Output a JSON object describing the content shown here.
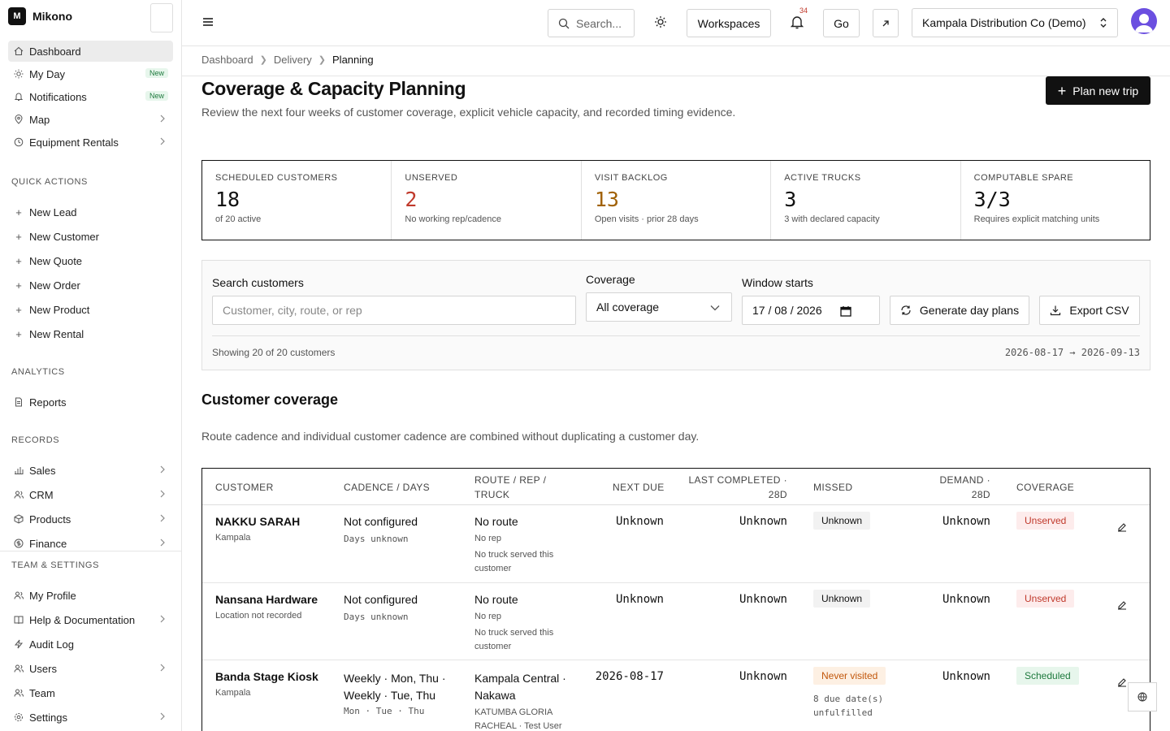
{
  "brand": {
    "logo_letter": "M",
    "name": "Mikono"
  },
  "sidebar": {
    "main": [
      {
        "label": "Dashboard",
        "icon": "home-icon",
        "active": true
      },
      {
        "label": "My Day",
        "icon": "sun-icon",
        "badge": "New"
      },
      {
        "label": "Notifications",
        "icon": "bell-icon",
        "badge": "New"
      },
      {
        "label": "Map",
        "icon": "map-pin-icon"
      },
      {
        "label": "Equipment Rentals",
        "icon": "clock-icon"
      }
    ],
    "quick_actions_label": "QUICK ACTIONS",
    "quick_actions": [
      "New Lead",
      "New Customer",
      "New Quote",
      "New Order",
      "New Product",
      "New Rental"
    ],
    "analytics_label": "ANALYTICS",
    "analytics": [
      {
        "label": "Reports",
        "icon": "file-icon"
      }
    ],
    "records_label": "RECORDS",
    "records": [
      {
        "label": "Sales",
        "icon": "bar-chart-icon"
      },
      {
        "label": "CRM",
        "icon": "users-icon"
      },
      {
        "label": "Products",
        "icon": "box-icon"
      },
      {
        "label": "Finance",
        "icon": "dollar-icon"
      }
    ],
    "team_label": "TEAM & SETTINGS",
    "team": [
      {
        "label": "My Profile",
        "icon": "users-icon"
      },
      {
        "label": "Help & Documentation",
        "icon": "book-icon"
      },
      {
        "label": "Audit Log",
        "icon": "activity-icon"
      },
      {
        "label": "Users",
        "icon": "users-icon"
      },
      {
        "label": "Team",
        "icon": "users-icon"
      },
      {
        "label": "Settings",
        "icon": "gear-icon"
      }
    ]
  },
  "topbar": {
    "search_placeholder": "Search...",
    "workspaces": "Workspaces",
    "notif_count": "34",
    "go": "Go",
    "company": "Kampala Distribution Co (Demo)"
  },
  "breadcrumb": [
    "Dashboard",
    "Delivery",
    "Planning"
  ],
  "page": {
    "title": "Coverage & Capacity Planning",
    "subtitle": "Review the next four weeks of customer coverage, explicit vehicle capacity, and recorded timing evidence.",
    "plan_button": "Plan new trip"
  },
  "kpis": [
    {
      "label": "SCHEDULED CUSTOMERS",
      "value": "18",
      "note": "of 20 active",
      "color": "#111111"
    },
    {
      "label": "UNSERVED",
      "value": "2",
      "note": "No working rep/cadence",
      "color": "#c0392b"
    },
    {
      "label": "VISIT BACKLOG",
      "value": "13",
      "note": "Open visits · prior 28 days",
      "color": "#a16207"
    },
    {
      "label": "ACTIVE TRUCKS",
      "value": "3",
      "note": "3 with declared capacity",
      "color": "#111111"
    },
    {
      "label": "COMPUTABLE SPARE",
      "value": "3/3",
      "note": "Requires explicit matching units",
      "color": "#111111"
    }
  ],
  "filters": {
    "search_label": "Search customers",
    "search_placeholder": "Customer, city, route, or rep",
    "coverage_label": "Coverage",
    "coverage_value": "All coverage",
    "window_label": "Window starts",
    "window_value": "17 / 08 / 2026",
    "generate_button": "Generate day plans",
    "export_button": "Export CSV",
    "showing": "Showing 20 of 20 customers",
    "range": "2026-08-17 → 2026-09-13"
  },
  "coverage_section": {
    "title": "Customer coverage",
    "subtitle": "Route cadence and individual customer cadence are combined without duplicating a customer day."
  },
  "table": {
    "headers": [
      "CUSTOMER",
      "CADENCE / DAYS",
      "ROUTE / REP / TRUCK",
      "NEXT DUE",
      "LAST COMPLETED · 28D",
      "MISSED",
      "DEMAND · 28D",
      "COVERAGE"
    ],
    "rows": [
      {
        "customer": "NAKKU SARAH",
        "location": "Kampala",
        "cadence": "Not configured",
        "days": "Days unknown",
        "route": "No route",
        "rep": "No rep",
        "truck": "No truck served this customer",
        "next_due": "Unknown",
        "last_completed": "Unknown",
        "missed": "Unknown",
        "missed_note": "",
        "demand": "Unknown",
        "coverage": "Unserved"
      },
      {
        "customer": "Nansana Hardware",
        "location": "Location not recorded",
        "cadence": "Not configured",
        "days": "Days unknown",
        "route": "No route",
        "rep": "No rep",
        "truck": "No truck served this customer",
        "next_due": "Unknown",
        "last_completed": "Unknown",
        "missed": "Unknown",
        "missed_note": "",
        "demand": "Unknown",
        "coverage": "Unserved"
      },
      {
        "customer": "Banda Stage Kiosk",
        "location": "Kampala",
        "cadence": "Weekly · Mon, Thu · Weekly · Tue, Thu",
        "days": "Mon · Tue · Thu",
        "route": "Kampala Central · Nakawa",
        "rep": "KATUMBA GLORIA RACHEAL · Test User",
        "truck": "",
        "next_due": "2026-08-17",
        "last_completed": "Unknown",
        "missed": "Never visited",
        "missed_note": "8 due date(s) unfulfilled",
        "demand": "Unknown",
        "coverage": "Scheduled"
      }
    ]
  }
}
